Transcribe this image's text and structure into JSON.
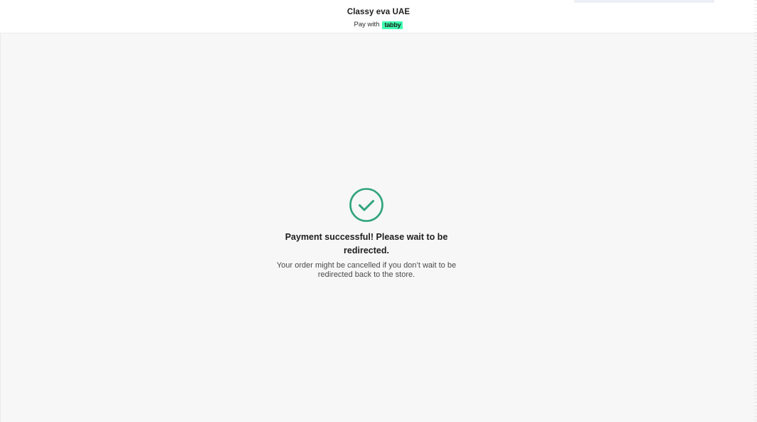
{
  "header": {
    "merchant_name": "Classy eva UAE",
    "pay_with_label": "Pay with",
    "brand_logo_text": "tabby"
  },
  "status": {
    "icon": "check-circle-icon",
    "title": "Payment successful! Please wait to be redirected.",
    "subtitle": "Your order might be cancelled if you don’t wait to be redirected back to the store."
  },
  "colors": {
    "background": "#f7f7f7",
    "header_background": "#ffffff",
    "success_green": "#2fa37c",
    "brand_green": "#3effb0"
  }
}
